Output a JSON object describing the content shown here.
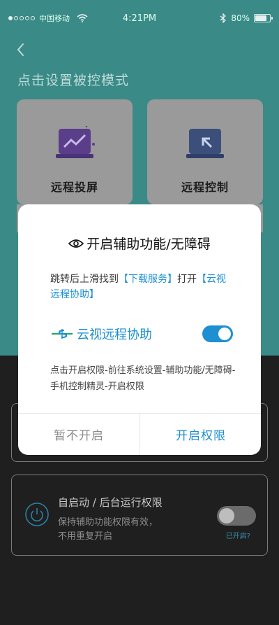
{
  "status_bar": {
    "carrier": "中国移动",
    "time": "4:21PM",
    "battery": "80%"
  },
  "page": {
    "title": "点击设置被控模式"
  },
  "mode_cards": [
    {
      "label": "远程投屏",
      "icon": "screen-cast-icon"
    },
    {
      "label": "远程控制",
      "icon": "remote-control-icon"
    }
  ],
  "background_item": {
    "title": "自启动 / 后台运行权限",
    "desc_line1": "保持辅助功能权限有效，",
    "desc_line2": "不用重复开启",
    "toggle_hint": "已开启?"
  },
  "modal": {
    "title": "开启辅助功能/无障碍",
    "instruction_pre": "跳转后上滑找到",
    "instruction_hl1": "【下载服务】",
    "instruction_mid": "打开",
    "instruction_hl2": "【云视远程协助】",
    "service_name": "云视远程协助",
    "steps": "点击开启权限-前往系统设置-辅助功能/无障碍-手机控制精灵-开启权限",
    "cancel_label": "暂不开启",
    "confirm_label": "开启权限"
  },
  "colors": {
    "accent": "#1e8fd0",
    "header_bg": "#3a8a87",
    "overlay_dark": "#1f1f1f"
  }
}
